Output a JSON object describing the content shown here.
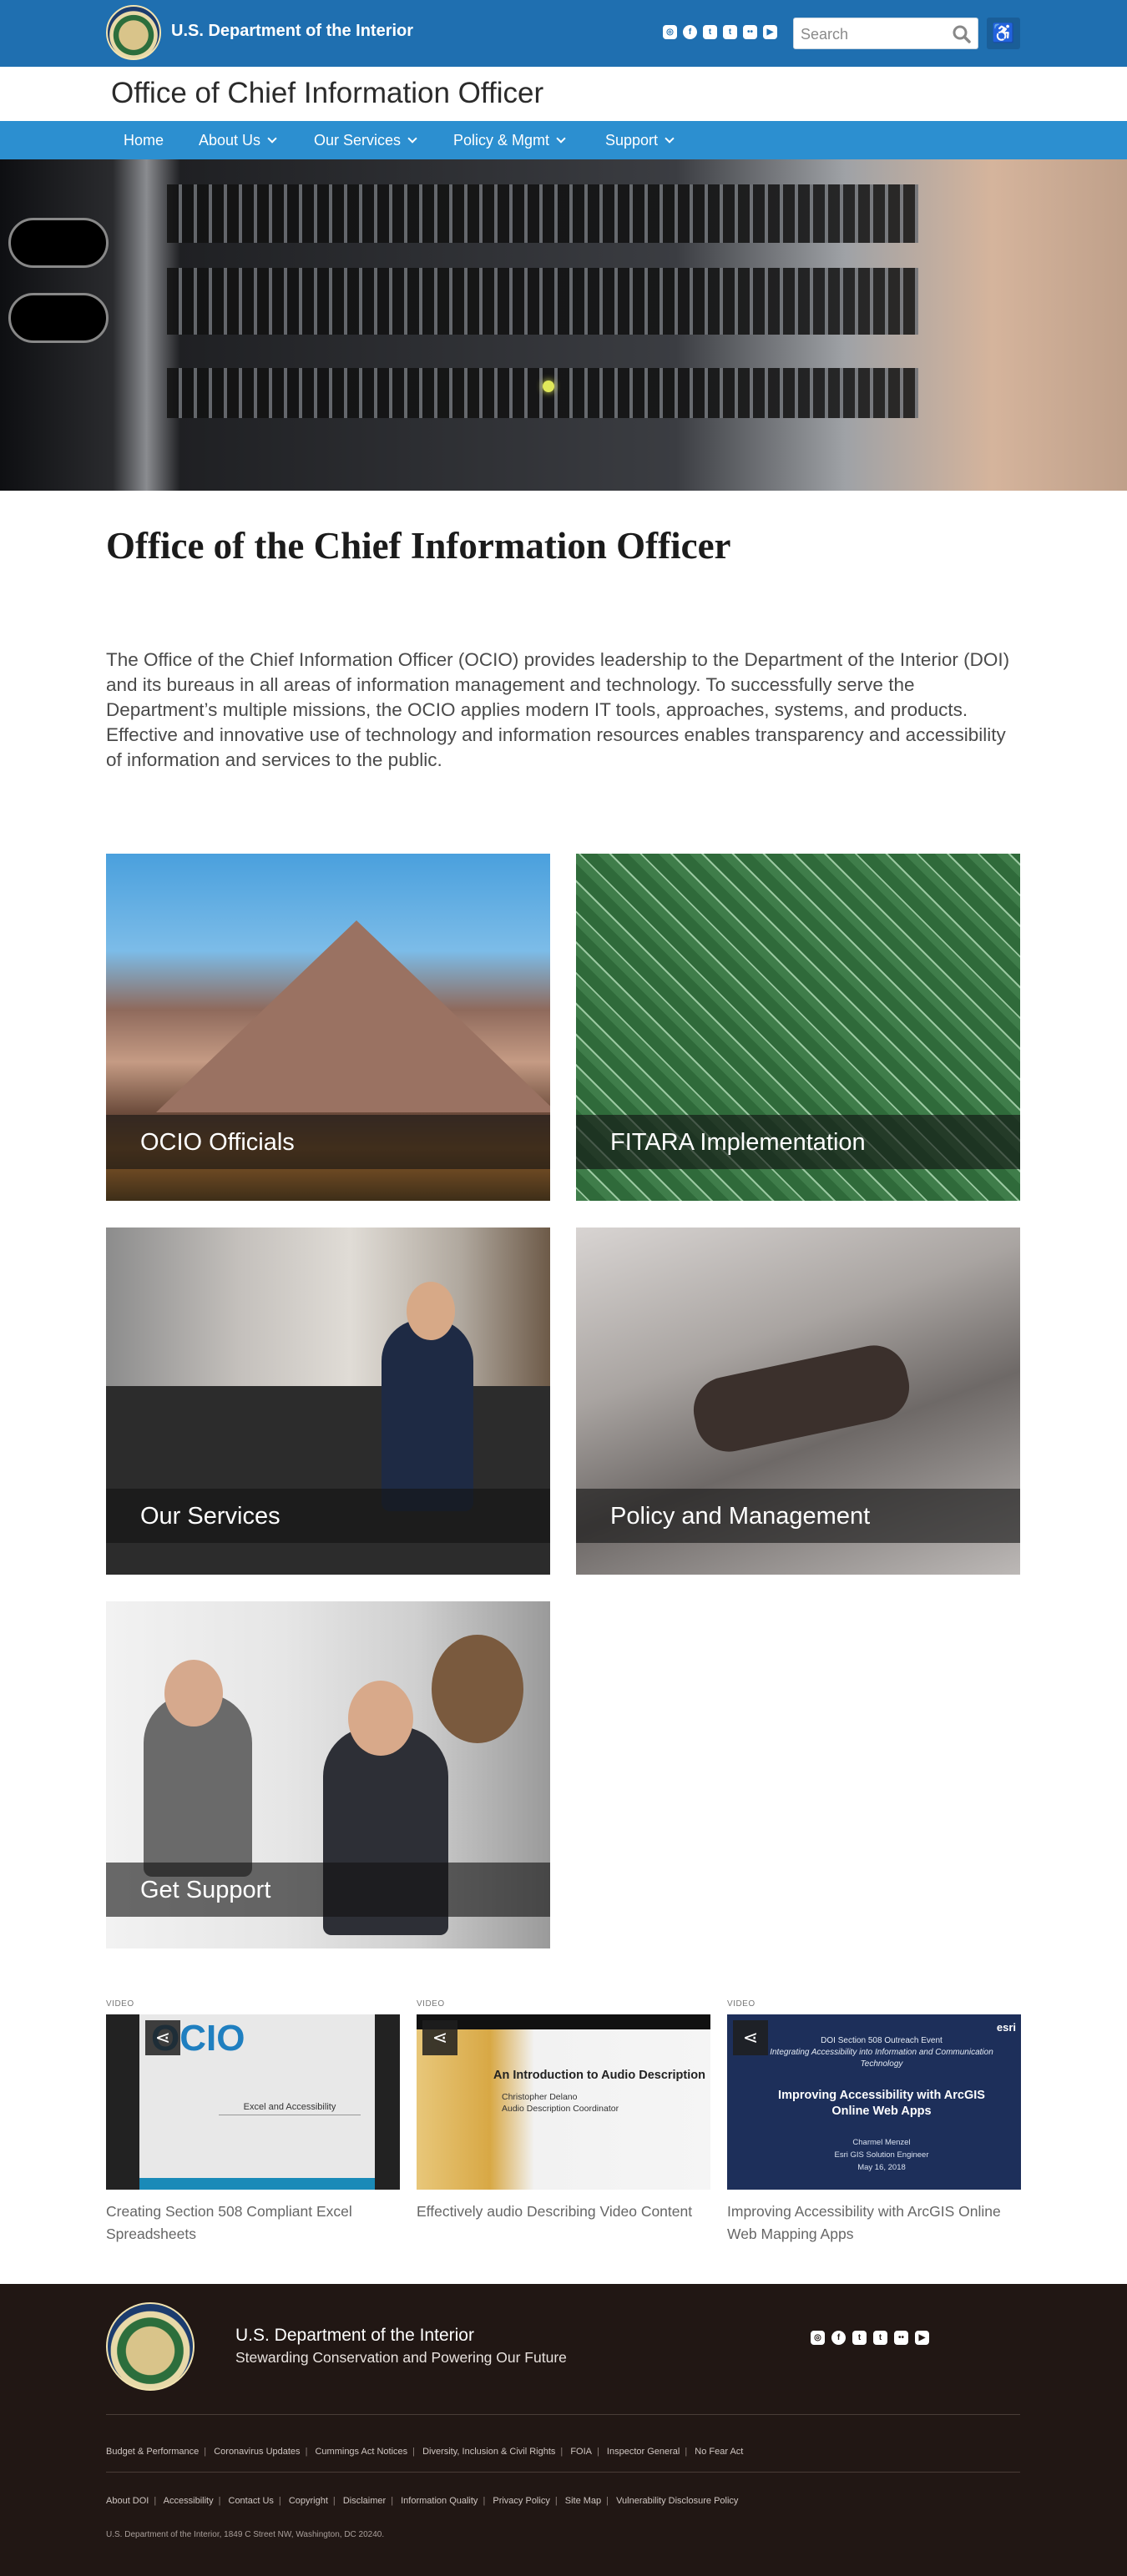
{
  "header": {
    "dept_name": "U.S. Department of the Interior",
    "search_placeholder": "Search",
    "social_icons": [
      "instagram-icon",
      "facebook-icon",
      "twitter-icon",
      "tumblr-icon",
      "flickr-icon",
      "youtube-icon"
    ],
    "accessibility_icon": "accessibility-icon"
  },
  "site_title": "Office of Chief Information Officer",
  "nav": {
    "items": [
      {
        "label": "Home",
        "has_dropdown": false
      },
      {
        "label": "About Us",
        "has_dropdown": true
      },
      {
        "label": "Our Services",
        "has_dropdown": true
      },
      {
        "label": "Policy & Mgmt",
        "has_dropdown": true
      },
      {
        "label": "Support",
        "has_dropdown": true
      }
    ]
  },
  "main": {
    "title": "Office of the Chief Information Officer",
    "intro": "The Office of the Chief Information Officer (OCIO) provides leadership to the Department of the Interior (DOI) and its bureaus in all areas of information management and technology.  To successfully serve the Department’s multiple missions, the OCIO applies modern IT tools, approaches, systems, and products.  Effective and innovative use of technology and information resources enables transparency and accessibility of information and services to the public."
  },
  "cards": [
    {
      "label": "OCIO Officials"
    },
    {
      "label": "FITARA Implementation"
    },
    {
      "label": "Our Services"
    },
    {
      "label": "Policy and Management"
    },
    {
      "label": "Get Support"
    }
  ],
  "videos": [
    {
      "tag": "VIDEO",
      "title": "Creating Section 508 Compliant Excel Spreadsheets",
      "thumb": {
        "logo": "OCIO",
        "heading": "Excel and Accessibility"
      }
    },
    {
      "tag": "VIDEO",
      "title": "Effectively audio Describing Video Content",
      "thumb": {
        "heading": "An Introduction to Audio Description",
        "name": "Christopher Delano",
        "role": "Audio Description Coordinator"
      }
    },
    {
      "tag": "VIDEO",
      "title": "Improving Accessibility with ArcGIS Online Web Mapping Apps",
      "thumb": {
        "event": "DOI Section 508 Outreach Event",
        "subtitle": "Integrating Accessibility into Information and Communication Technology",
        "heading": "Improving Accessibility with ArcGIS Online Web Apps",
        "speaker": "Charmel Menzel",
        "speaker_role": "Esri GIS Solution Engineer",
        "date": "May 16, 2018",
        "brand": "esri"
      }
    }
  ],
  "footer": {
    "dept_name": "U.S. Department of the Interior",
    "tagline": "Stewarding Conservation and Powering Our Future",
    "links_row1": [
      "Budget & Performance",
      "Coronavirus Updates",
      "Cummings Act Notices",
      "Diversity, Inclusion & Civil Rights",
      "FOIA",
      "Inspector General",
      "No Fear Act"
    ],
    "links_row2": [
      "About DOI",
      "Accessibility",
      "Contact Us",
      "Copyright",
      "Disclaimer",
      "Information Quality",
      "Privacy Policy",
      "Site Map",
      "Vulnerability Disclosure Policy"
    ],
    "address": "U.S. Department of the Interior, 1849 C Street NW, Washington, DC 20240."
  },
  "colors": {
    "topbar": "#1f6fb0",
    "nav": "#2c8fd0",
    "footer": "#211714"
  }
}
